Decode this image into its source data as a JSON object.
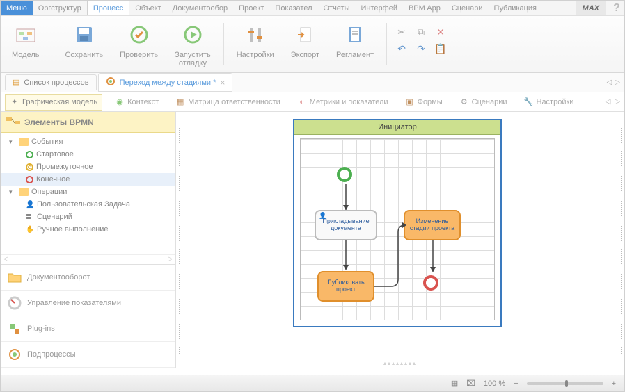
{
  "menubar": {
    "menu": "Меню",
    "items": [
      "Оргструктур",
      "Процесс",
      "Объект",
      "Документообор",
      "Проект",
      "Показател",
      "Отчеты",
      "Интерфей",
      "BPM App",
      "Сценари",
      "Публикация"
    ],
    "active_index": 1,
    "max": "MAX",
    "help": "?"
  },
  "ribbon": {
    "groups": [
      {
        "label": "Модель"
      },
      {
        "label": "Сохранить"
      },
      {
        "label": "Проверить"
      },
      {
        "label": "Запустить\nотладку"
      },
      {
        "label": "Настройки"
      },
      {
        "label": "Экспорт"
      },
      {
        "label": "Регламент"
      }
    ]
  },
  "tabs": {
    "items": [
      {
        "label": "Список процессов"
      },
      {
        "label": "Переход между стадиями *",
        "active": true
      }
    ]
  },
  "subtabs": {
    "items": [
      {
        "label": "Графическая модель",
        "active": true
      },
      {
        "label": "Контекст"
      },
      {
        "label": "Матрица ответственности"
      },
      {
        "label": "Метрики и показатели"
      },
      {
        "label": "Формы"
      },
      {
        "label": "Сценарии"
      },
      {
        "label": "Настройки"
      }
    ]
  },
  "sidebar": {
    "header": "Элементы BPMN",
    "tree": {
      "events_label": "События",
      "events_children": [
        {
          "label": "Стартовое",
          "color": "#4caf50"
        },
        {
          "label": "Промежуточное",
          "color": "#e0b030"
        },
        {
          "label": "Конечное",
          "color": "#d9534f",
          "selected": true
        }
      ],
      "ops_label": "Операции",
      "ops_children": [
        {
          "label": "Пользовательская Задача"
        },
        {
          "label": "Сценарий"
        },
        {
          "label": "Ручное выполнение"
        }
      ]
    },
    "panels": [
      {
        "label": "Документооборот"
      },
      {
        "label": "Управление показателями"
      },
      {
        "label": "Plug-ins"
      },
      {
        "label": "Подпроцессы"
      }
    ]
  },
  "diagram": {
    "lane": "Инициатор",
    "task1": "Прикладывание документа",
    "task2": "Изменение стадии проекта",
    "task3": "Публиковать проект"
  },
  "statusbar": {
    "zoom": "100 %"
  }
}
